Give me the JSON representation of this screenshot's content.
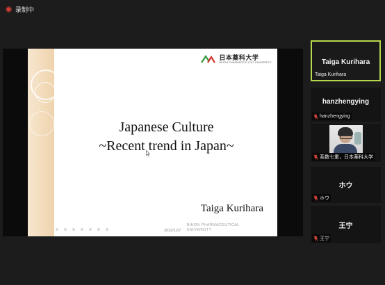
{
  "recording": {
    "label": "录制中"
  },
  "slide": {
    "university_name": "日本薬科大学",
    "university_sub": "NIHON PHARMACEUTICAL UNIVERSITY",
    "title_line1": "Japanese Culture",
    "title_line2": "~Recent trend in Japan~",
    "presenter": "Taiga Kurihara",
    "date": "2022/12/7",
    "footer_uni_line1": "NIHON PHARMACEUTICAL",
    "footer_uni_line2": "UNIVERSITY"
  },
  "participants": [
    {
      "display": "Taiga Kurihara",
      "tag": "Taiga Kurihara",
      "active_speaker": true,
      "muted": false
    },
    {
      "display": "hanzhengying",
      "tag": "hanzhengying",
      "muted": true
    },
    {
      "display": "",
      "tag": "系数七重，日本薬科大学",
      "muted": true,
      "video": true
    },
    {
      "display": "ホウ",
      "tag": "ホウ",
      "muted": true
    },
    {
      "display": "王宁",
      "tag": "王宁",
      "muted": true
    }
  ],
  "colors": {
    "active_border": "#b7d84d",
    "muted_icon": "#e04a3a",
    "rec_dot": "#d23b2f"
  },
  "icons": [
    "record-icon",
    "mic-muted-icon",
    "cursor-icon",
    "logo-mark-icon"
  ]
}
